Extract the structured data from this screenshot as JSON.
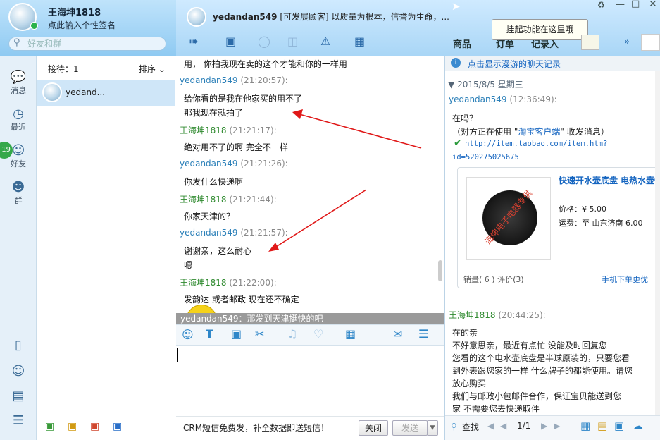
{
  "app": {
    "username": "王海坤1818",
    "signature": "点此输入个性签名",
    "search_placeholder": "好友和群"
  },
  "nav": {
    "message": "消息",
    "recent": "最近",
    "friends": "好友",
    "groups": "群",
    "badge": "19"
  },
  "contacts": {
    "reception": "接待：1",
    "sort": "排序",
    "active": "yedand..."
  },
  "chat": {
    "peer_name": "yedandan549",
    "peer_status": "[可发展顾客]",
    "peer_slogan": "以质量为根本，信誉为生命，...",
    "tabs": {
      "goods": "商品",
      "order": "订单",
      "record": "记录入"
    },
    "tooltip": "挂起功能在这里哦",
    "messages": [
      {
        "kind": "text",
        "text": "用， 你拍我现在卖的这个才能和你的一样用"
      },
      {
        "kind": "head",
        "name": "yedandan549",
        "time": "(21:20:57):",
        "self": false
      },
      {
        "kind": "text",
        "text": "给你看的是我在他家买的用不了"
      },
      {
        "kind": "text",
        "text": "那我现在就拍了"
      },
      {
        "kind": "head",
        "name": "王海坤1818",
        "time": "(21:21:17):",
        "self": true
      },
      {
        "kind": "text",
        "text": "绝对用不了的啊  完全不一样"
      },
      {
        "kind": "head",
        "name": "yedandan549",
        "time": "(21:21:26):",
        "self": false
      },
      {
        "kind": "text",
        "text": "你发什么快递啊"
      },
      {
        "kind": "head",
        "name": "王海坤1818",
        "time": "(21:21:44):",
        "self": true
      },
      {
        "kind": "text",
        "text": "你家天津的？"
      },
      {
        "kind": "head",
        "name": "yedandan549",
        "time": "(21:21:57):",
        "self": false
      },
      {
        "kind": "text",
        "text": "谢谢亲，这么耐心"
      },
      {
        "kind": "text",
        "text": "嗯"
      },
      {
        "kind": "head",
        "name": "王海坤1818",
        "time": "(21:22:00):",
        "self": true
      },
      {
        "kind": "text",
        "text": "发韵达  或者邮政  现在还不确定"
      }
    ],
    "preview_bar": "yedandan549：那发到天津挺快的吧",
    "sms_text": "CRM短信免费发，补全数据即送短信！",
    "close_label": "关闭",
    "send_label": "发送"
  },
  "history": {
    "roam_link": "点击显示漫游的聊天记录",
    "date": "2015/8/5 星期三",
    "peer_head": "yedandan549",
    "peer_time": "(12:36:49):",
    "q1": "在吗？",
    "client_note_pre": "（对方正在使用 \"",
    "client_note_link": "淘宝客户端",
    "client_note_post": "\" 收发消息）",
    "url": "http://item.taobao.com/item.htm?",
    "url2": "id=520275025675",
    "product": {
      "title": "快速开水壶底盘 电热水壶快速烧水壶底盘配件",
      "price_label": "价格：",
      "price": "¥ 5.00",
      "ship_label": "运费：",
      "ship": "至 山东济南 6.00",
      "sales": "销量(  6  )  评价(3)",
      "buy": "手机下单更优",
      "watermark": "海坤电子电器专供"
    },
    "self_head": "王海坤1818",
    "self_time": "(20:44:25):",
    "reply": [
      "在的亲",
      "不好意思亲，最近有点忙 没能及时回复您",
      "您看的这个电水壶底盘是半球原装的，只要您看",
      "到外表跟您家的一样 什么牌子的都能使用。请您",
      "放心购买",
      "我们与邮政小包邮件合作，保证宝贝能送到您",
      "家   不需要您去快递取件"
    ],
    "search": "查找",
    "page": "1/1"
  }
}
